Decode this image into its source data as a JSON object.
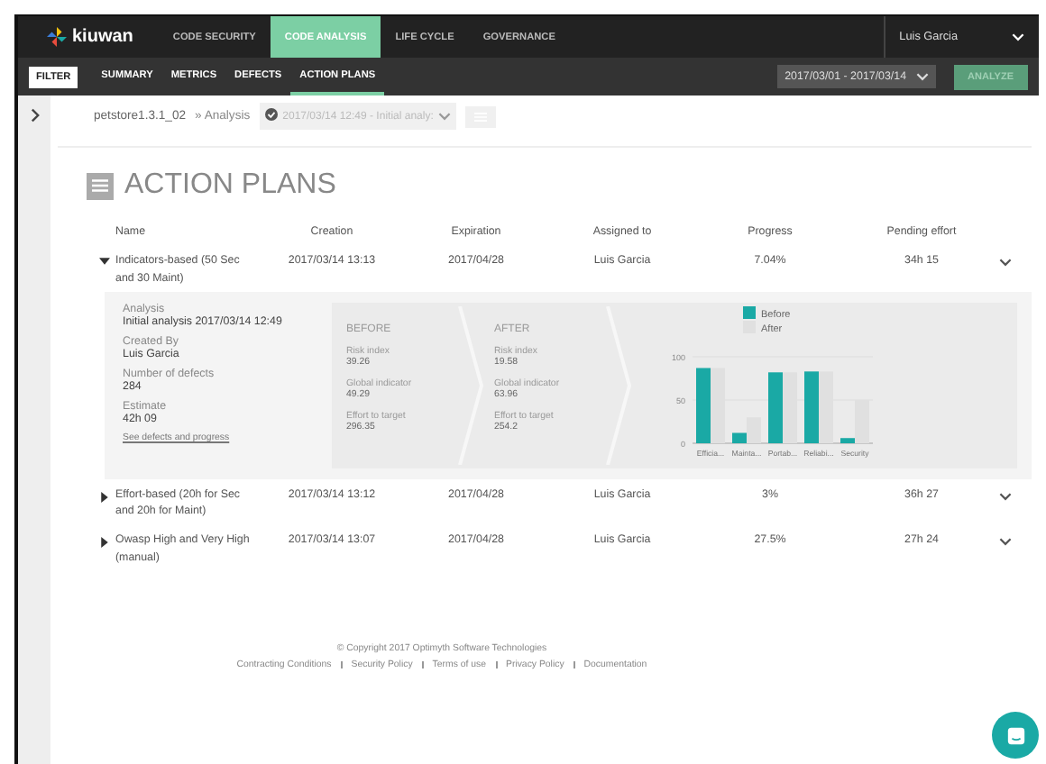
{
  "header": {
    "logo": "kiuwan",
    "nav": [
      {
        "label": "CODE SECURITY",
        "selected": false
      },
      {
        "label": "CODE ANALYSIS",
        "selected": true
      },
      {
        "label": "LIFE CYCLE",
        "selected": false
      },
      {
        "label": "GOVERNANCE",
        "selected": false
      }
    ],
    "user": "Luis Garcia"
  },
  "subnav": {
    "tabs": [
      {
        "label": "FILTER",
        "kind": "filter",
        "selected": false
      },
      {
        "label": "SUMMARY",
        "kind": "tab",
        "selected": false
      },
      {
        "label": "METRICS",
        "kind": "tab",
        "selected": false
      },
      {
        "label": "DEFECTS",
        "kind": "tab",
        "selected": false
      },
      {
        "label": "ACTION PLANS",
        "kind": "tab",
        "selected": true
      }
    ],
    "date_range": "2017/03/01 - 2017/03/14",
    "analyze_button": "ANALYZE"
  },
  "breadcrumb": {
    "app": "petstore1.3.1_02",
    "section": "» Analysis",
    "analysis": "2017/03/14 12:49 - Initial analy:"
  },
  "title": "ACTION PLANS",
  "table": {
    "columns": [
      "Name",
      "Creation",
      "Expiration",
      "Assigned to",
      "Progress",
      "Pending effort"
    ],
    "rows": [
      {
        "name": "Indicators-based (50 Sec and 30 Maint)",
        "creation": "2017/03/14 13:13",
        "expiration": "2017/04/28",
        "assigned": "Luis Garcia",
        "progress": "7.04%",
        "pending": "34h 15",
        "expanded": true,
        "detail": {
          "info": [
            {
              "label": "Analysis",
              "value": "Initial analysis 2017/03/14 12:49"
            },
            {
              "label": "Created By",
              "value": "Luis Garcia"
            },
            {
              "label": "Number of defects",
              "value": "284"
            },
            {
              "label": "Estimate",
              "value": "42h 09"
            }
          ],
          "link": "See defects and progress",
          "stages": [
            {
              "title": "BEFORE",
              "metrics": [
                {
                  "label": "Risk index",
                  "value": "39.26"
                },
                {
                  "label": "Global indicator",
                  "value": "49.29"
                },
                {
                  "label": "Effort to target",
                  "value": "296.35"
                }
              ]
            },
            {
              "title": "AFTER",
              "metrics": [
                {
                  "label": "Risk index",
                  "value": "19.58"
                },
                {
                  "label": "Global indicator",
                  "value": "63.96"
                },
                {
                  "label": "Effort to target",
                  "value": "254.2"
                }
              ]
            }
          ],
          "chart_data": {
            "type": "bar",
            "categories": [
              "Efficia...",
              "Mainta...",
              "Portab...",
              "Reliabi...",
              "Security"
            ],
            "series": [
              {
                "name": "Before",
                "color": "#1aa9a5",
                "values": [
                  87,
                  12,
                  82,
                  83,
                  6
                ]
              },
              {
                "name": "After",
                "color": "#e0e0e0",
                "values": [
                  87,
                  30,
                  82,
                  83,
                  50
                ]
              }
            ],
            "ylim": [
              0,
              100
            ],
            "yticks": [
              0,
              50,
              100
            ],
            "legend": "top"
          }
        }
      },
      {
        "name": "Effort-based (20h for Sec and 20h for Maint)",
        "creation": "2017/03/14 13:12",
        "expiration": "2017/04/28",
        "assigned": "Luis Garcia",
        "progress": "3%",
        "pending": "36h 27",
        "expanded": false
      },
      {
        "name": "Owasp High and Very High (manual)",
        "creation": "2017/03/14 13:07",
        "expiration": "2017/04/28",
        "assigned": "Luis Garcia",
        "progress": "27.5%",
        "pending": "27h 24",
        "expanded": false
      }
    ]
  },
  "footer": {
    "copyright": "© Copyright 2017 Optimyth Software Technologies",
    "links": [
      "Contracting Conditions",
      "Security Policy",
      "Terms of use",
      "Privacy Policy",
      "Documentation"
    ]
  }
}
